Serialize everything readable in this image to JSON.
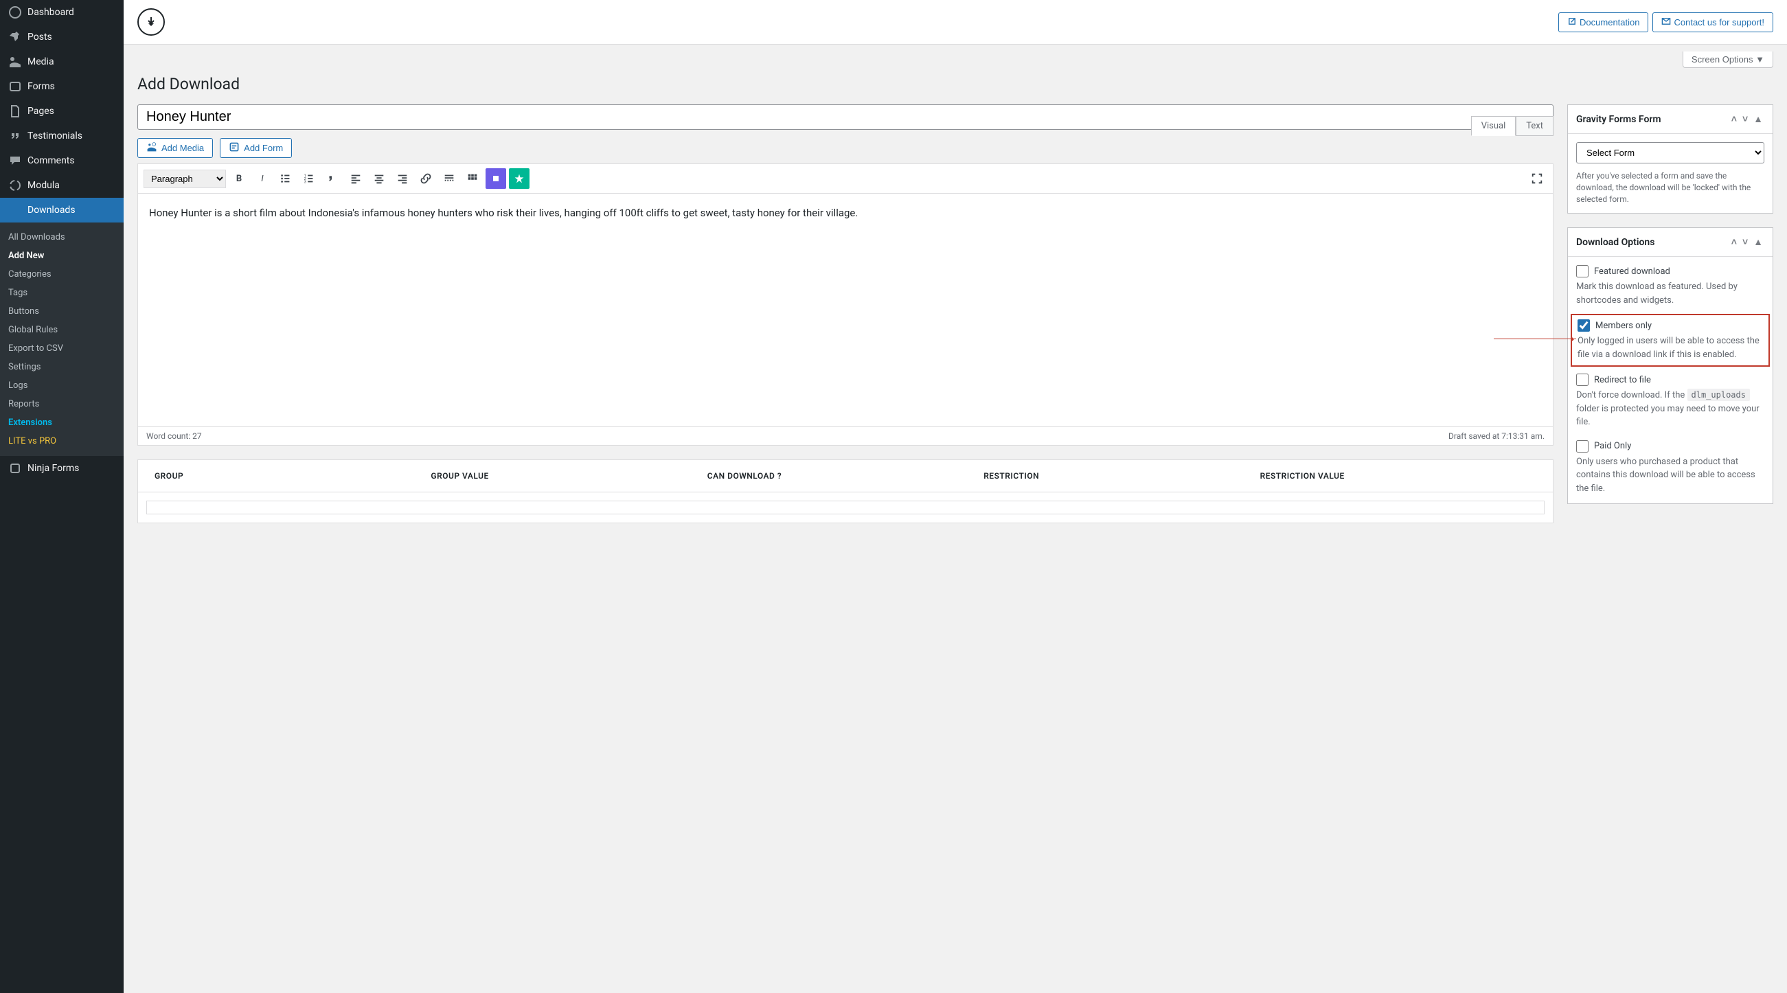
{
  "sidebar": {
    "items": [
      {
        "label": "Dashboard",
        "icon": "dashboard"
      },
      {
        "label": "Posts",
        "icon": "pin"
      },
      {
        "label": "Media",
        "icon": "media"
      },
      {
        "label": "Forms",
        "icon": "forms"
      },
      {
        "label": "Pages",
        "icon": "page"
      },
      {
        "label": "Testimonials",
        "icon": "quote"
      },
      {
        "label": "Comments",
        "icon": "comment"
      },
      {
        "label": "Modula",
        "icon": "modula"
      },
      {
        "label": "Downloads",
        "icon": "download"
      },
      {
        "label": "Ninja Forms",
        "icon": "ninja"
      }
    ],
    "submenu": [
      {
        "label": "All Downloads"
      },
      {
        "label": "Add New",
        "current": true
      },
      {
        "label": "Categories"
      },
      {
        "label": "Tags"
      },
      {
        "label": "Buttons"
      },
      {
        "label": "Global Rules"
      },
      {
        "label": "Export to CSV"
      },
      {
        "label": "Settings"
      },
      {
        "label": "Logs"
      },
      {
        "label": "Reports"
      },
      {
        "label": "Extensions",
        "style": "teal"
      },
      {
        "label": "LITE vs PRO",
        "style": "gold"
      }
    ]
  },
  "topbar": {
    "documentation": "Documentation",
    "contact": "Contact us for support!"
  },
  "screen_options": "Screen Options ▼",
  "page_title": "Add Download",
  "title_value": "Honey Hunter",
  "media_btns": {
    "add_media": "Add Media",
    "add_form": "Add Form"
  },
  "editor": {
    "tabs": {
      "visual": "Visual",
      "text": "Text"
    },
    "format": "Paragraph",
    "content": "Honey Hunter is a short film about Indonesia's infamous honey hunters who risk their lives, hanging off 100ft cliffs to get sweet, tasty honey for their village.",
    "word_count": "Word count: 27",
    "draft_saved": "Draft saved at 7:13:31 am."
  },
  "access_table": {
    "cols": [
      "GROUP",
      "GROUP VALUE",
      "CAN DOWNLOAD ?",
      "RESTRICTION",
      "RESTRICTION VALUE"
    ]
  },
  "panel_gravity": {
    "title": "Gravity Forms Form",
    "select": "Select Form",
    "help": "After you've selected a form and save the download, the download will be 'locked' with the selected form."
  },
  "panel_options": {
    "title": "Download Options",
    "featured": {
      "label": "Featured download",
      "desc": "Mark this download as featured. Used by shortcodes and widgets."
    },
    "members": {
      "label": "Members only",
      "desc": "Only logged in users will be able to access the file via a download link if this is enabled."
    },
    "redirect": {
      "label": "Redirect to file",
      "desc_pre": "Don't force download. If the ",
      "code": "dlm_uploads",
      "desc_post": " folder is protected you may need to move your file."
    },
    "paid": {
      "label": "Paid Only",
      "desc": "Only users who purchased a product that contains this download will be able to access the file."
    }
  }
}
